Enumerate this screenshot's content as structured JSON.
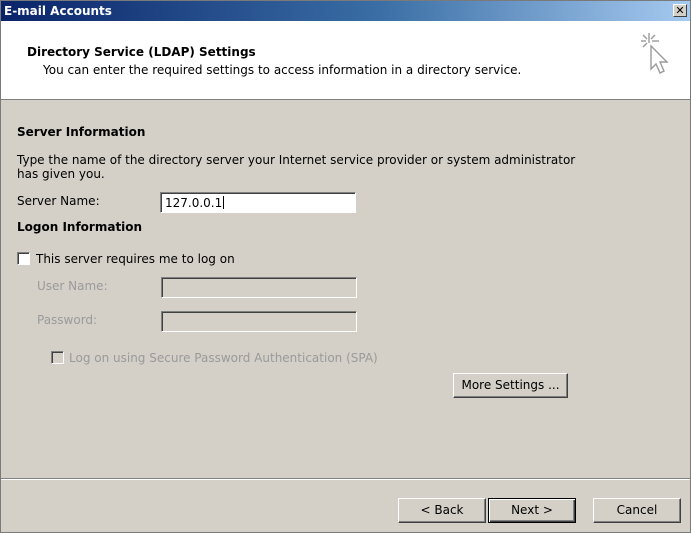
{
  "window": {
    "title": "E-mail Accounts"
  },
  "header": {
    "title": "Directory Service (LDAP) Settings",
    "subtitle": "You can enter the required settings to access information in a directory service."
  },
  "server_info": {
    "section_title": "Server Information",
    "description_line1": "Type the name of the directory server your Internet service provider or system administrator",
    "description_line2": "has given you.",
    "server_name_label": "Server Name:",
    "server_name_value": "127.0.0.1"
  },
  "logon_info": {
    "section_title": "Logon Information",
    "requires_logon_label": "This server requires me to log on",
    "requires_logon_checked": false,
    "user_name_label": "User Name:",
    "user_name_value": "",
    "password_label": "Password:",
    "password_value": "",
    "spa_label": "Log on using Secure Password Authentication (SPA)",
    "spa_checked": false
  },
  "buttons": {
    "more_settings": "More Settings ...",
    "back": "< Back",
    "next": "Next >",
    "cancel": "Cancel"
  },
  "icons": {
    "close": "close-icon",
    "wizard": "wizard-cursor-icon"
  }
}
